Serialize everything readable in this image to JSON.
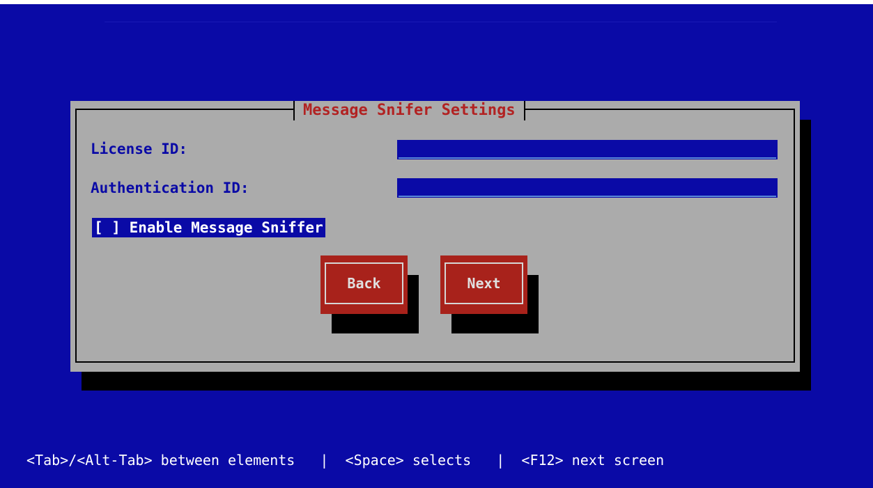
{
  "dialog": {
    "title": "Message Snifer Settings",
    "license_label": "License ID:",
    "license_value": "",
    "auth_label": "Authentication ID:",
    "auth_value": "",
    "checkbox_label": "[ ] Enable Message Sniffer",
    "checkbox_checked": false,
    "back_label": "Back",
    "next_label": "Next"
  },
  "help_bar": {
    "text": "<Tab>/<Alt-Tab> between elements   |  <Space> selects   |  <F12> next screen"
  },
  "colors": {
    "background": "#0a0aa6",
    "dialog": "#ababab",
    "title_text": "#b22222",
    "button": "#a8221b",
    "field": "#0a0aa6"
  }
}
